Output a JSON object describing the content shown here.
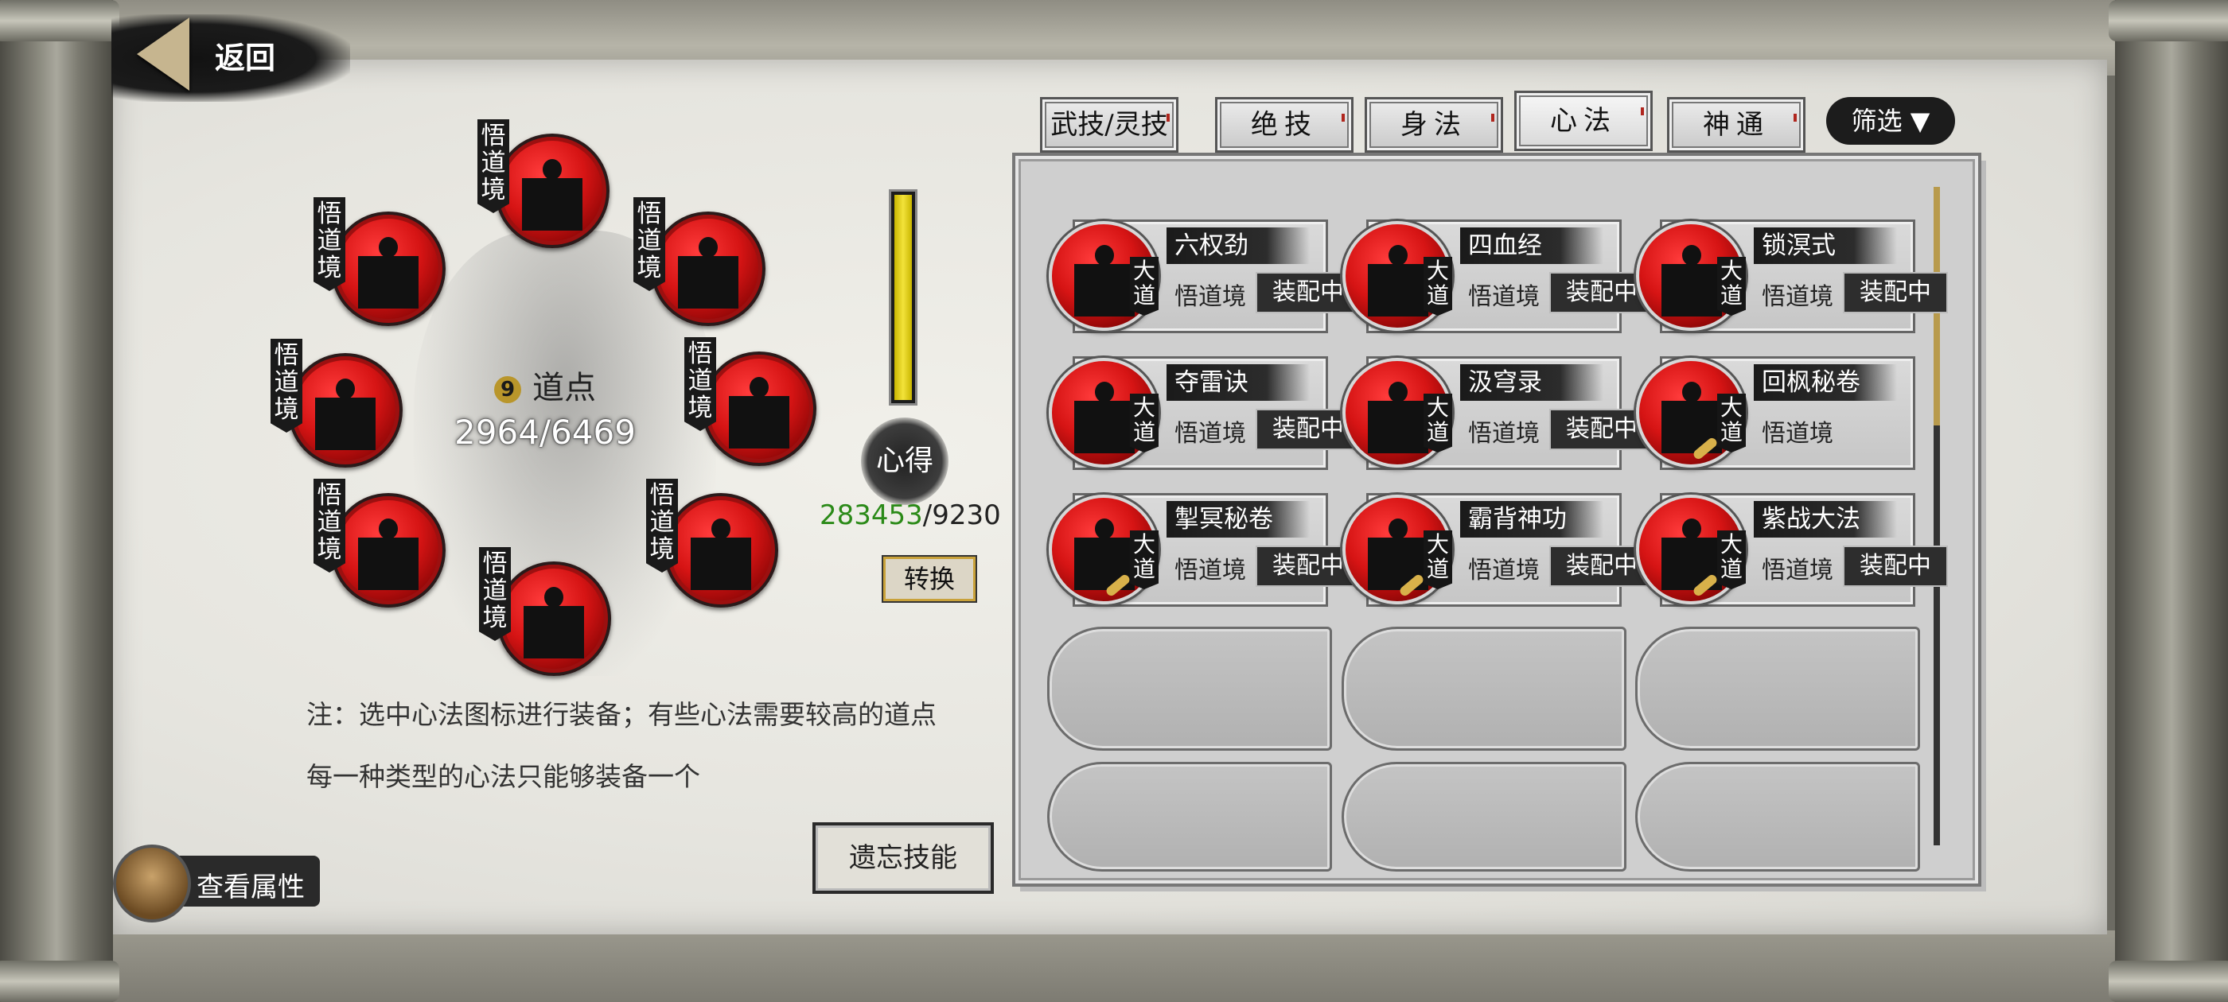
{
  "header": {
    "back_label": "返回"
  },
  "skill_ring": {
    "slots": [
      {
        "tag": "悟道境"
      },
      {
        "tag": "悟道境"
      },
      {
        "tag": "悟道境"
      },
      {
        "tag": "悟道境"
      },
      {
        "tag": "悟道境"
      },
      {
        "tag": "悟道境"
      },
      {
        "tag": "悟道境"
      },
      {
        "tag": "悟道境"
      }
    ],
    "dao_icon_glyph": "9",
    "dao_label": "道点",
    "dao_value": "2964/6469"
  },
  "xinde": {
    "label": "心得",
    "current": "283453",
    "max": "/9230",
    "fill_ratio": 1.0,
    "convert_label": "转换",
    "gauge_color": "#f3e33a"
  },
  "notes": [
    "注：选中心法图标进行装备；有些心法需要较高的道点",
    "每一种类型的心法只能够装备一个"
  ],
  "buttons": {
    "forget": "遗忘技能",
    "view_attributes": "查看属性",
    "filter": "筛选 ▼"
  },
  "tabs": [
    {
      "label": "武技/灵技",
      "active": false
    },
    {
      "label": "绝技",
      "active": false
    },
    {
      "label": "身法",
      "active": false
    },
    {
      "label": "心法",
      "active": true
    },
    {
      "label": "神通",
      "active": false
    }
  ],
  "cards": [
    {
      "name": "六权劲",
      "tag": "大道",
      "realm": "悟道境",
      "status": "装配中"
    },
    {
      "name": "四血经",
      "tag": "大道",
      "realm": "悟道境",
      "status": "装配中"
    },
    {
      "name": "锁溟式",
      "tag": "大道",
      "realm": "悟道境",
      "status": "装配中"
    },
    {
      "name": "夺雷诀",
      "tag": "大道",
      "realm": "悟道境",
      "status": "装配中"
    },
    {
      "name": "汲穹录",
      "tag": "大道",
      "realm": "悟道境",
      "status": "装配中"
    },
    {
      "name": "回枫秘卷",
      "tag": "大道",
      "realm": "悟道境",
      "status": ""
    },
    {
      "name": "掣冥秘卷",
      "tag": "大道",
      "realm": "悟道境",
      "status": "装配中"
    },
    {
      "name": "霸背神功",
      "tag": "大道",
      "realm": "悟道境",
      "status": "装配中"
    },
    {
      "name": "紫战大法",
      "tag": "大道",
      "realm": "悟道境",
      "status": "装配中"
    }
  ],
  "colors": {
    "accent_red": "#d61414",
    "xinde_green": "#2b8a18",
    "gold": "#b89a4c"
  }
}
